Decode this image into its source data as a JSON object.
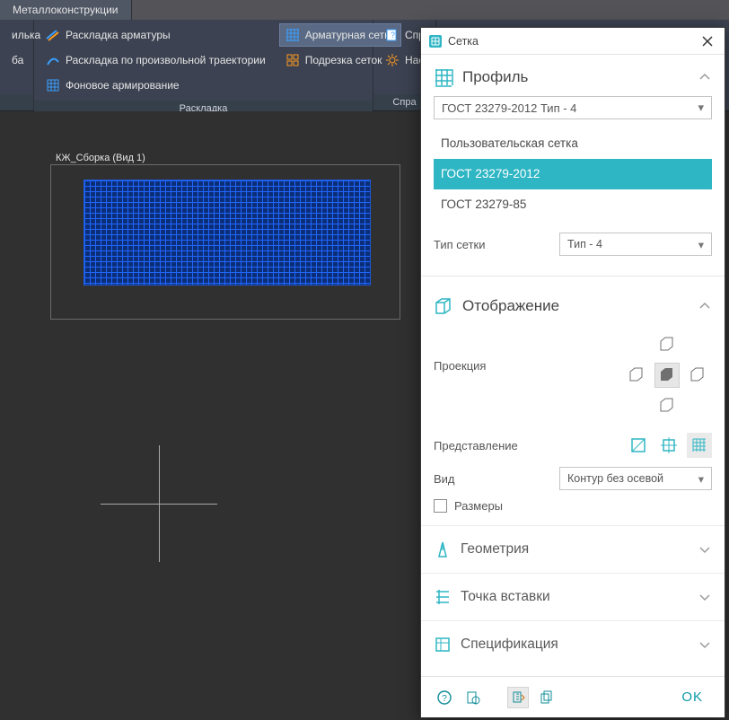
{
  "tabs": {
    "active_tab": "Металлоконструкции"
  },
  "ribbon": {
    "group0": {
      "btn0": "илька",
      "btn1": "ба"
    },
    "layout_group": {
      "title": "Раскладка",
      "rebar_layout": "Раскладка арматуры",
      "curve_layout": "Раскладка по произвольной траектории",
      "background_rebar": "Фоновое армирование",
      "mesh_rebar": "Арматурная сетка",
      "mesh_cut": "Подрезка сеток"
    },
    "help_group": {
      "title": "Спра",
      "help": "Справка",
      "settings": "Наст"
    }
  },
  "viewport": {
    "label": "КЖ_Сборка (Вид 1)"
  },
  "dialog": {
    "title": "Сетка",
    "profile": {
      "header": "Профиль",
      "selected": "ГОСТ 23279-2012 Тип - 4",
      "options": [
        "Пользовательская сетка",
        "ГОСТ 23279-2012",
        "ГОСТ 23279-85"
      ],
      "type_label": "Тип сетки",
      "type_value": "Тип - 4"
    },
    "display": {
      "header": "Отображение",
      "projection_label": "Проекция",
      "representation_label": "Представление",
      "view_label": "Вид",
      "view_value": "Контур без осевой",
      "dimensions_label": "Размеры"
    },
    "geometry_header": "Геометрия",
    "insert_header": "Точка вставки",
    "spec_header": "Спецификация",
    "ok": "OK"
  }
}
